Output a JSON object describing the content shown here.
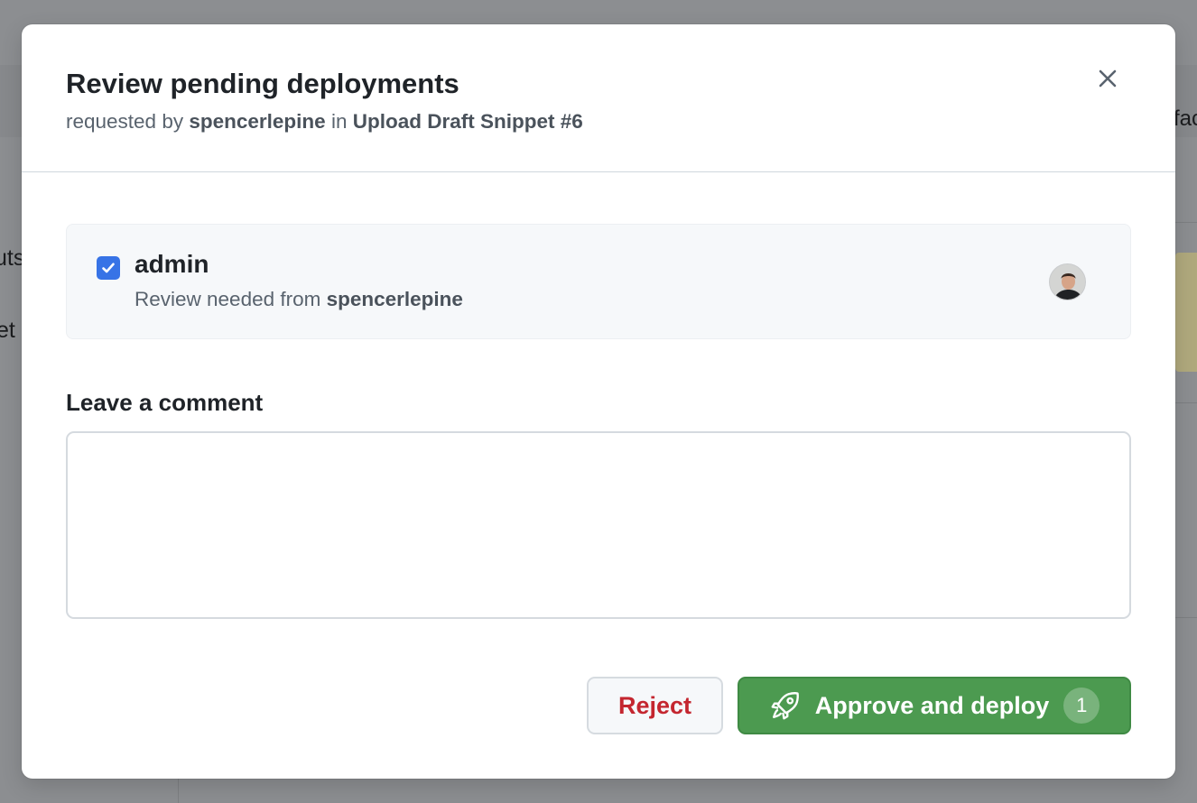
{
  "background": {
    "fragment_left_1": "uts",
    "fragment_left_2": "et",
    "fragment_right": "fac"
  },
  "dialog": {
    "title": "Review pending deployments",
    "subtitle_prefix": "requested by",
    "requester": "spencerlepine",
    "subtitle_in": "in",
    "workflow_run": "Upload Draft Snippet #6",
    "close_icon": "close-icon"
  },
  "environment": {
    "checked": true,
    "name": "admin",
    "review_prefix": "Review needed from",
    "reviewer": "spencerlepine"
  },
  "comment": {
    "label": "Leave a comment",
    "value": ""
  },
  "actions": {
    "reject_label": "Reject",
    "approve_label": "Approve and deploy",
    "approve_icon": "rocket-icon",
    "approve_count": "1"
  },
  "colors": {
    "approve": "#4c9a50",
    "reject_text": "#c4262f",
    "checkbox": "#3773e6",
    "overlay": "#8c8e91"
  }
}
